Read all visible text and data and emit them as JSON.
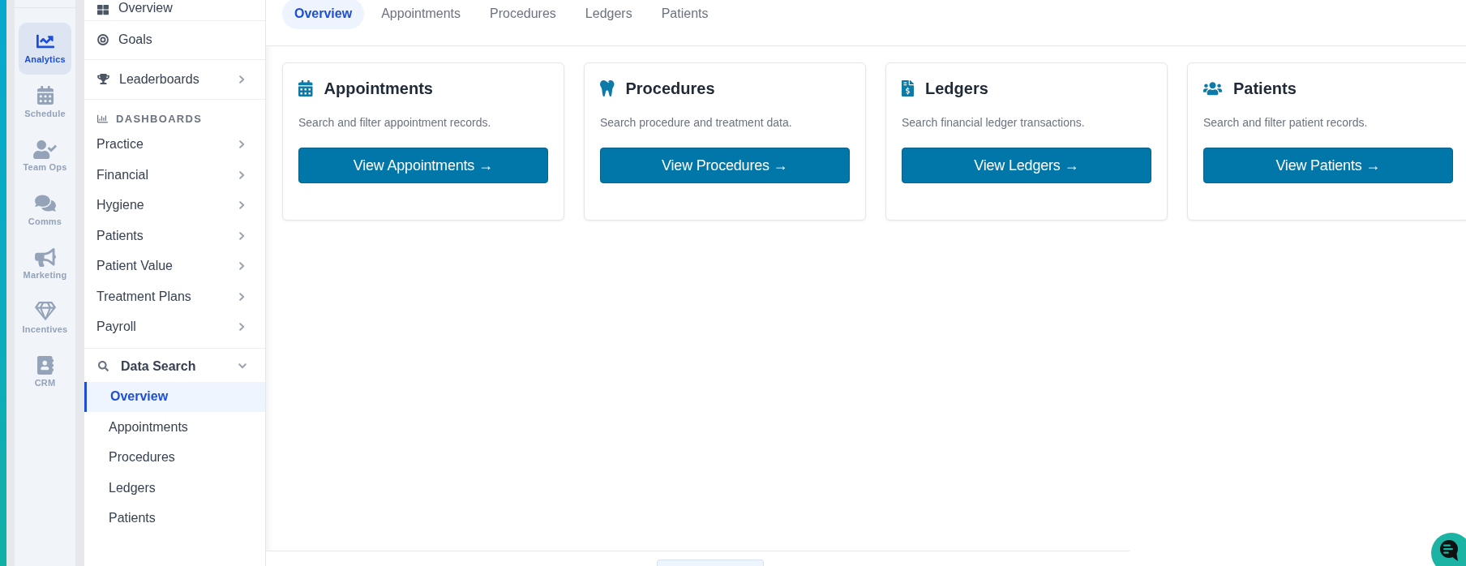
{
  "rail": {
    "items": [
      {
        "label": "Analytics",
        "selected": true
      },
      {
        "label": "Schedule",
        "selected": false
      },
      {
        "label": "Team Ops",
        "selected": false
      },
      {
        "label": "Comms",
        "selected": false
      },
      {
        "label": "Marketing",
        "selected": false
      },
      {
        "label": "Incentives",
        "selected": false
      },
      {
        "label": "CRM",
        "selected": false
      }
    ]
  },
  "sidebar": {
    "links": [
      {
        "label": "Overview",
        "kind": "link"
      },
      {
        "label": "Goals",
        "kind": "link"
      },
      {
        "label": "Leaderboards",
        "kind": "submenu"
      }
    ],
    "dashboards": {
      "heading": "DASHBOARDS",
      "items": [
        {
          "label": "Practice",
          "expanded": false
        },
        {
          "label": "Financial",
          "expanded": false
        },
        {
          "label": "Hygiene",
          "expanded": false
        },
        {
          "label": "Patients",
          "expanded": false
        },
        {
          "label": "Patient Value",
          "expanded": false
        },
        {
          "label": "Treatment Plans",
          "expanded": false
        },
        {
          "label": "Payroll",
          "expanded": false
        }
      ]
    },
    "data_search": {
      "label": "Data Search",
      "expanded": true,
      "children": [
        {
          "label": "Overview",
          "selected": true
        },
        {
          "label": "Appointments",
          "selected": false
        },
        {
          "label": "Procedures",
          "selected": false
        },
        {
          "label": "Ledgers",
          "selected": false
        },
        {
          "label": "Patients",
          "selected": false
        }
      ]
    }
  },
  "tabs": [
    {
      "label": "Overview",
      "selected": true
    },
    {
      "label": "Appointments",
      "selected": false
    },
    {
      "label": "Procedures",
      "selected": false
    },
    {
      "label": "Ledgers",
      "selected": false
    },
    {
      "label": "Patients",
      "selected": false
    }
  ],
  "cards": [
    {
      "title": "Appointments",
      "description": "Search and filter appointment records.",
      "button": "View Appointments →"
    },
    {
      "title": "Procedures",
      "description": "Search procedure and treatment data.",
      "button": "View Procedures →"
    },
    {
      "title": "Ledgers",
      "description": "Search financial ledger transactions.",
      "button": "View Ledgers →"
    },
    {
      "title": "Patients",
      "description": "Search and filter patient records.",
      "button": "View Patients →"
    }
  ]
}
